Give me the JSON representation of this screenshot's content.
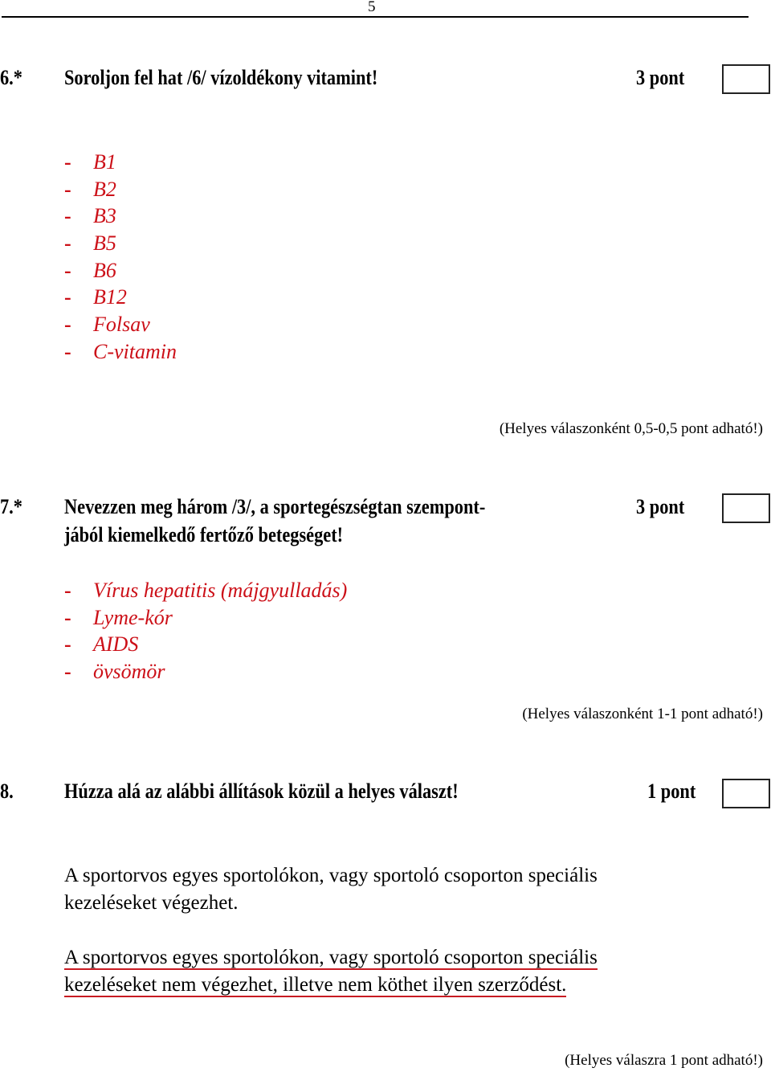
{
  "page": {
    "number": "5"
  },
  "questions": [
    {
      "number": "6.*",
      "text_lines": [
        "Soroljon fel hat /6/ vízoldékony vitamint!"
      ],
      "points": "3 pont",
      "answers": [
        "B1",
        "B2",
        "B3",
        "B5",
        "B6",
        "B12",
        "Folsav",
        "C-vitamin"
      ],
      "note": "(Helyes válaszonként 0,5-0,5 pont adható!)"
    },
    {
      "number": "7.*",
      "text_lines": [
        "Nevezzen meg három /3/, a sportegészségtan szempont-",
        "jából kiemelkedő fertőző betegséget!"
      ],
      "points": "3 pont",
      "answers": [
        "Vírus hepatitis (májgyulladás)",
        "Lyme-kór",
        "AIDS",
        "övsömör"
      ],
      "note": "(Helyes válaszonként 1-1 pont adható!)"
    },
    {
      "number": "8.",
      "text_lines": [
        "Húzza alá az alábbi állítások közül a helyes választ!"
      ],
      "points": "1 pont",
      "statements": [
        {
          "lines": [
            "A sportorvos egyes sportolókon, vagy sportoló csoporton speciális",
            "kezeléseket végezhet."
          ],
          "underlined": false
        },
        {
          "lines": [
            "A sportorvos egyes sportolókon, vagy sportoló csoporton speciális",
            "kezeléseket nem végezhet, illetve nem köthet ilyen szerződést."
          ],
          "underlined": true
        }
      ],
      "note": "(Helyes válaszra 1 pont adható!)"
    }
  ],
  "dash": "-",
  "colors": {
    "answer_red": "#cc1018",
    "underline_red": "#c81a22"
  }
}
